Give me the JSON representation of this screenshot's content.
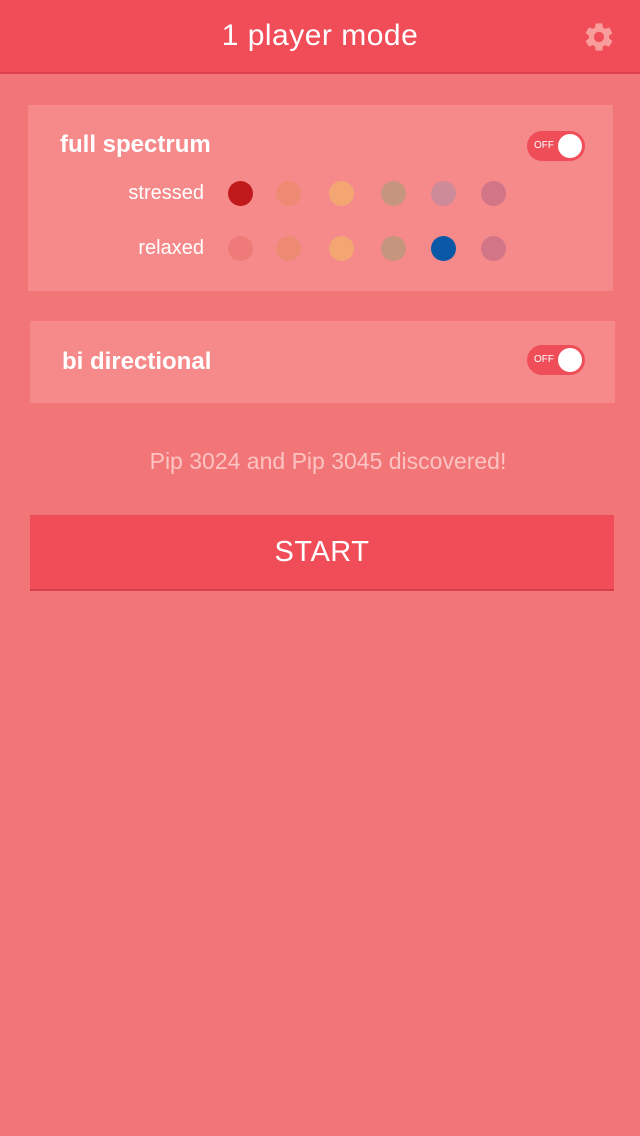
{
  "header": {
    "title": "1 player mode",
    "settings_icon": "gear-icon"
  },
  "full_spectrum": {
    "label": "full spectrum",
    "toggle": "OFF",
    "rows": [
      {
        "label": "stressed",
        "colors": [
          "#c0191c",
          "#ee8a74",
          "#f3a671",
          "#c5957d",
          "#cd8a98",
          "#d27587"
        ]
      },
      {
        "label": "relaxed",
        "colors": [
          "#ee7b7a",
          "#ee8a74",
          "#f3a671",
          "#c5957d",
          "#0a58a6",
          "#d27587"
        ]
      }
    ]
  },
  "bi_directional": {
    "label": "bi directional",
    "toggle": "OFF"
  },
  "status": "Pip 3024  and Pip 3045 discovered!",
  "start_label": "START"
}
